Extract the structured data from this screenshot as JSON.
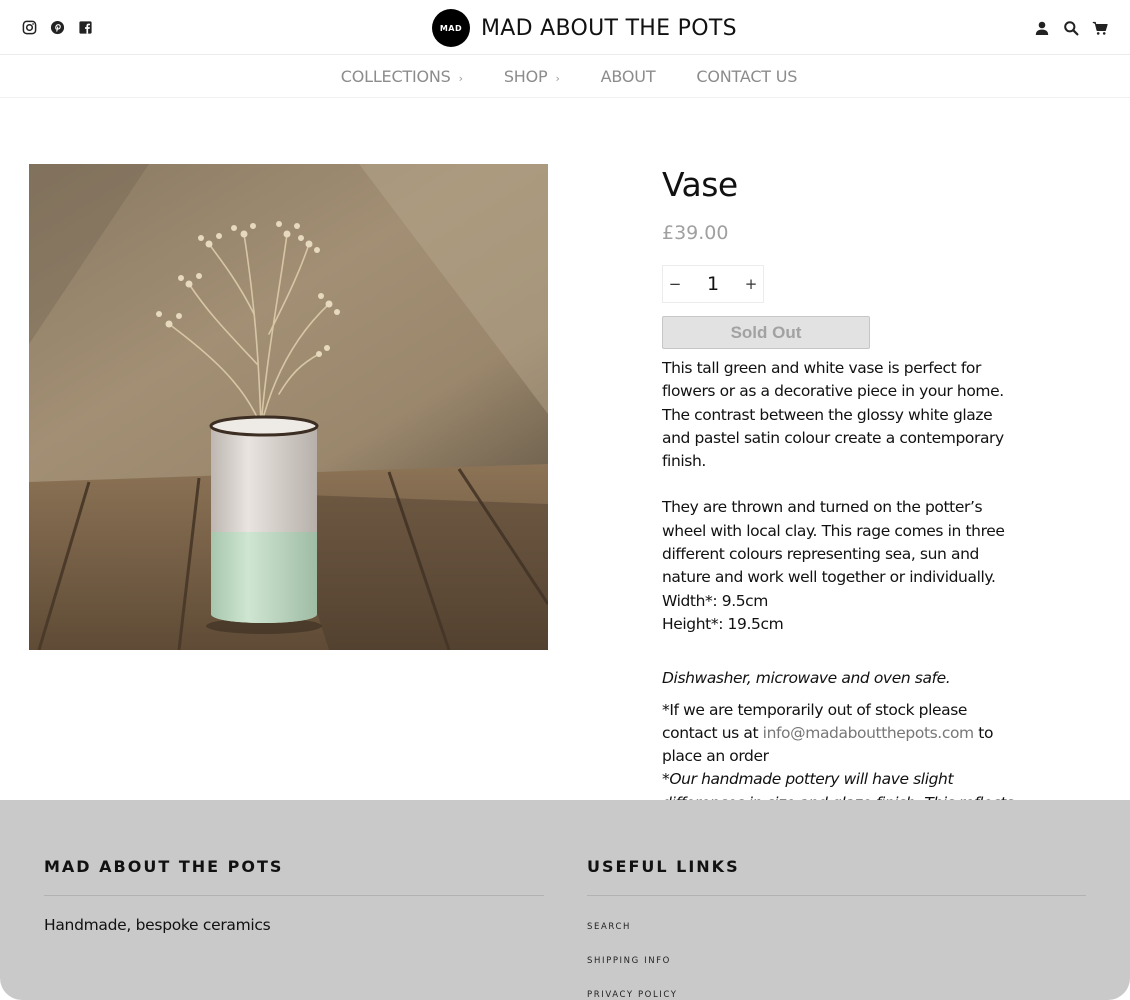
{
  "header": {
    "brand_name": "MAD ABOUT THE POTS",
    "logo_text": "MAD",
    "social_icons": [
      "instagram-icon",
      "pinterest-icon",
      "facebook-icon"
    ],
    "tool_icons": [
      "account-icon",
      "search-icon",
      "cart-icon"
    ]
  },
  "nav": {
    "items": [
      {
        "label": "COLLECTIONS",
        "has_chevron": true
      },
      {
        "label": "SHOP",
        "has_chevron": true
      },
      {
        "label": "ABOUT",
        "has_chevron": false
      },
      {
        "label": "CONTACT US",
        "has_chevron": false
      }
    ],
    "chevron": "›"
  },
  "product": {
    "title": "Vase",
    "price": "£39.00",
    "quantity": "1",
    "minus_label": "−",
    "plus_label": "+",
    "sold_out_label": "Sold Out",
    "description": {
      "p1": "This tall green and white vase is perfect for flowers or as a decorative piece in your home. The contrast between the glossy white glaze and pastel satin colour create a contemporary finish.",
      "p2": "They are thrown and turned on the potter’s wheel with local clay. This rage comes in three different colours representing sea, sun and nature and work well together or individually.",
      "width": "Width*: 9.5cm",
      "height": "Height*: 19.5cm",
      "care": "Dishwasher, microwave and oven safe.",
      "stock_prefix": "*If we are temporarily out of stock please contact us at ",
      "stock_email": "info@madaboutthepots.com",
      "stock_suffix": " to place an order",
      "handmade_note": "*Our handmade pottery will have slight differences in size and glaze finish. This reflects the artisan nature of the product"
    }
  },
  "footer": {
    "col1_heading": "MAD ABOUT THE POTS",
    "col1_text": "Handmade, bespoke ceramics",
    "col2_heading": "USEFUL LINKS",
    "links": [
      "SEARCH",
      "SHIPPING INFO",
      "PRIVACY POLICY"
    ]
  },
  "colors": {
    "accent": "#000000",
    "price": "#a0a0a0",
    "nav_text": "#8c8c8c",
    "footer_bg": "#c9c9c9",
    "sold_out_bg": "#e2e2e2"
  }
}
